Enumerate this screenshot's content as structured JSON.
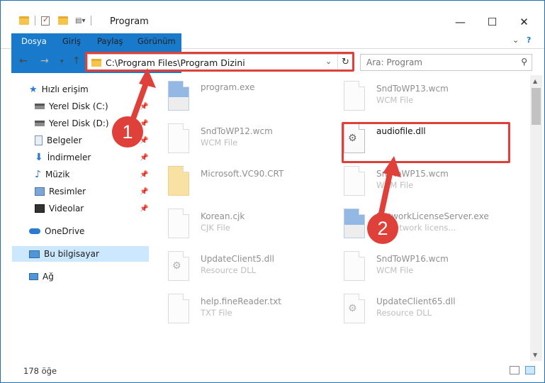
{
  "window": {
    "title": "Program",
    "controls": {
      "minimize": "—",
      "maximize": "☐",
      "close": "✕"
    }
  },
  "ribbon": {
    "tabs": [
      "Dosya",
      "Giriş",
      "Paylaş",
      "Görünüm"
    ],
    "help": "?"
  },
  "nav": {
    "address": "C:\\Program Files\\Program Dizini",
    "search_placeholder": "Ara: Program"
  },
  "sidebar": {
    "items": [
      {
        "label": "Hızlı erişim",
        "icon": "star-icon"
      },
      {
        "label": "Yerel Disk (C:)",
        "icon": "drive-icon"
      },
      {
        "label": "Yerel Disk (D:)",
        "icon": "drive-icon"
      },
      {
        "label": "Belgeler",
        "icon": "documents-icon"
      },
      {
        "label": "İndirmeler",
        "icon": "download-icon"
      },
      {
        "label": "Müzik",
        "icon": "music-icon"
      },
      {
        "label": "Resimler",
        "icon": "pictures-icon"
      },
      {
        "label": "Videolar",
        "icon": "video-icon"
      },
      {
        "label": "OneDrive",
        "icon": "cloud-icon"
      },
      {
        "label": "Bu bilgisayar",
        "icon": "computer-icon"
      },
      {
        "label": "Ağ",
        "icon": "network-icon"
      }
    ]
  },
  "files": [
    {
      "name": "program.exe",
      "type": ""
    },
    {
      "name": "SndToWP13.wcm",
      "type": "WCM File"
    },
    {
      "name": "SndToWP12.wcm",
      "type": "WCM File"
    },
    {
      "name": "audiofile.dll",
      "type": ""
    },
    {
      "name": "Microsoft.VC90.CRT",
      "type": ""
    },
    {
      "name": "SndToWP15.wcm",
      "type": "WCM File"
    },
    {
      "name": "Korean.cjk",
      "type": "CJK File"
    },
    {
      "name": "NetworkLicenseServer.exe",
      "type": "BY network licens..."
    },
    {
      "name": "UpdateClient5.dll",
      "type": "Resource DLL"
    },
    {
      "name": "SndToWP16.wcm",
      "type": "WCM File"
    },
    {
      "name": "help.fineReader.txt",
      "type": "TXT File"
    },
    {
      "name": "UpdateClient65.dll",
      "type": "Resource DLL"
    }
  ],
  "status": {
    "count": "178 öğe"
  },
  "callouts": {
    "one": "1",
    "two": "2"
  },
  "colors": {
    "accent": "#1979ca",
    "highlight": "#e0403a",
    "selected": "#cce8ff"
  }
}
